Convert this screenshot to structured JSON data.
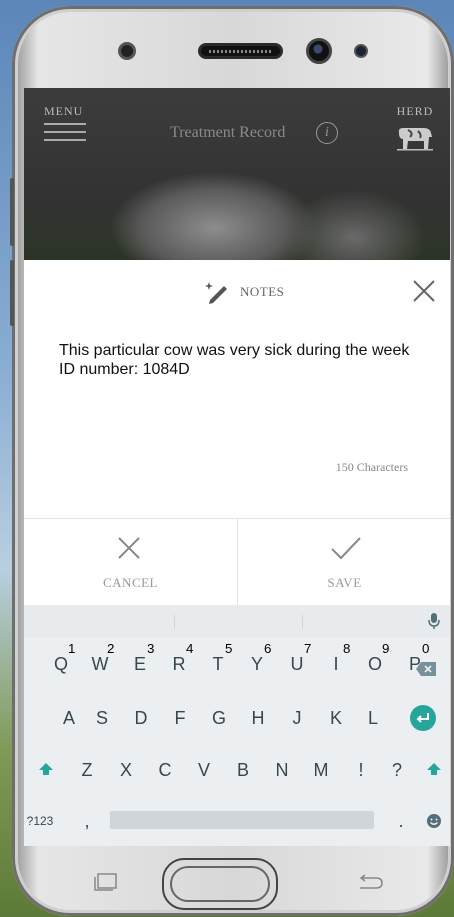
{
  "header": {
    "menu_label": "MENU",
    "title": "Treatment Record",
    "info_glyph": "i",
    "herd_label": "HERD"
  },
  "notes": {
    "label": "NOTES",
    "text": "This particular cow was very sick during the week\nID number: 1084D",
    "char_count": "150 Characters"
  },
  "actions": {
    "cancel_label": "CANCEL",
    "save_label": "SAVE"
  },
  "keyboard": {
    "row1": [
      {
        "k": "Q",
        "n": "1"
      },
      {
        "k": "W",
        "n": "2"
      },
      {
        "k": "E",
        "n": "3"
      },
      {
        "k": "R",
        "n": "4"
      },
      {
        "k": "T",
        "n": "5"
      },
      {
        "k": "Y",
        "n": "6"
      },
      {
        "k": "U",
        "n": "7"
      },
      {
        "k": "I",
        "n": "8"
      },
      {
        "k": "O",
        "n": "9"
      },
      {
        "k": "P",
        "n": "0"
      }
    ],
    "row2": [
      "A",
      "S",
      "D",
      "F",
      "G",
      "H",
      "J",
      "K",
      "L"
    ],
    "row3": [
      "Z",
      "X",
      "C",
      "V",
      "B",
      "N",
      "M",
      "!",
      "?"
    ],
    "symbols_label": "?123",
    "comma": ",",
    "period": "."
  },
  "colors": {
    "keyboard_accent": "#26a69a",
    "header_bg": "#3c3c3c"
  },
  "icons": {
    "menu": "hamburger-icon",
    "info": "info-icon",
    "herd": "cow-icon",
    "notes": "pencil-sparkle-icon",
    "close": "close-icon",
    "cancel": "close-icon",
    "save": "checkmark-icon"
  }
}
